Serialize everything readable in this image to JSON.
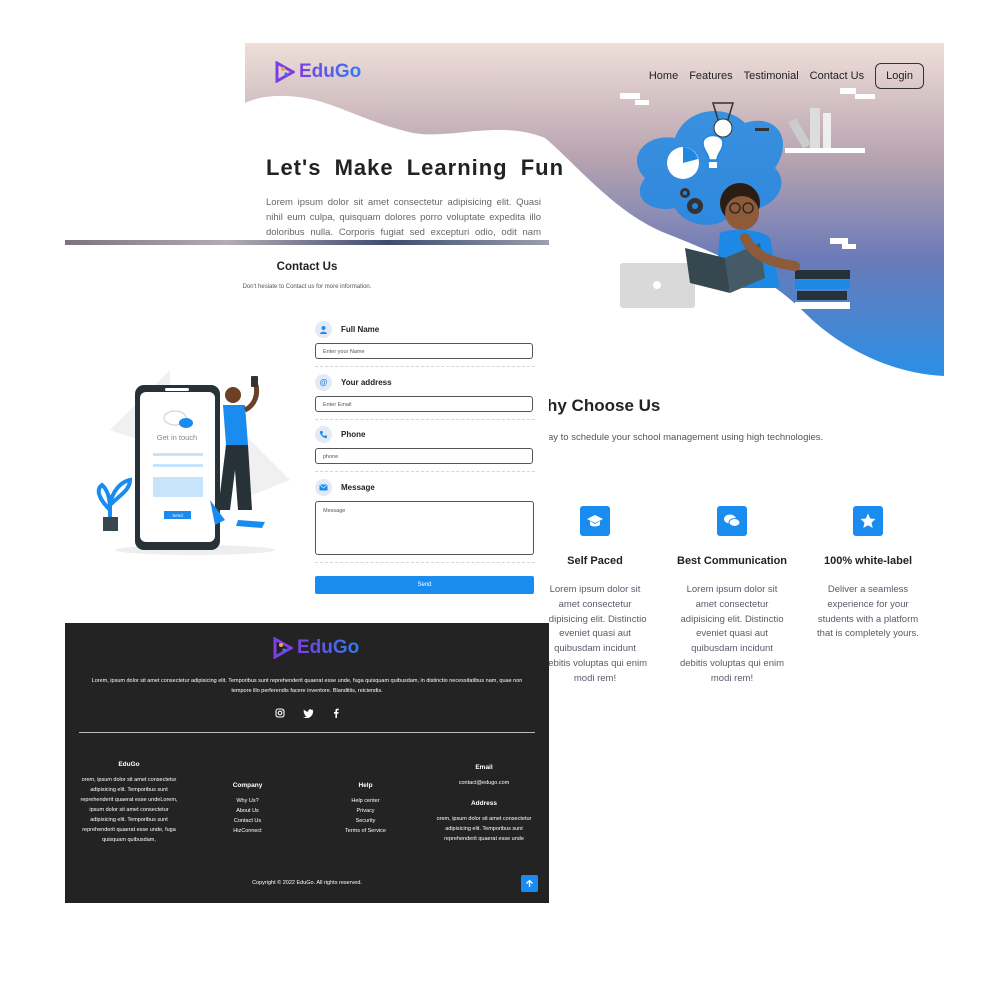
{
  "brand": {
    "name": "EduGo",
    "accent": "#1a8cf0",
    "footer_bg": "#232323"
  },
  "hero": {
    "nav": [
      "Home",
      "Features",
      "Testimonial",
      "Contact Us"
    ],
    "login_label": "Login",
    "title": "Let's Make Learning Fun",
    "lead": "Lorem ipsum dolor sit amet consectetur adipisicing elit. Quasi nihil eum culpa, quisquam dolores porro voluptate expedita illo doloribus nulla. Corporis fugiat sed excepturi odio, odit nam officia"
  },
  "why": {
    "title": "hy Choose Us",
    "subtitle": "ay to schedule your school management using high technologies.",
    "features": [
      {
        "icon": "graduation-cap-icon",
        "title": "Self Paced",
        "desc": "Lorem ipsum dolor sit amet consectetur adipisicing elit. Distinctio eveniet quasi aut quibusdam incidunt debitis voluptas qui enim modi rem!"
      },
      {
        "icon": "chat-bubbles-icon",
        "title": "Best Communication",
        "desc": "Lorem ipsum dolor sit amet consectetur adipisicing elit. Distinctio eveniet quasi aut quibusdam incidunt debitis voluptas qui enim modi rem!"
      },
      {
        "icon": "star-icon",
        "title": "100% white-label",
        "desc": "Deliver a seamless experience for your students with a platform that is completely yours."
      }
    ]
  },
  "contact": {
    "title": "Contact Us",
    "hint": "Don't hesiate to Contact us for more information.",
    "fields": [
      {
        "label": "Full Name",
        "placeholder": "Enter your Name",
        "icon": "user-icon"
      },
      {
        "label": "Your address",
        "placeholder": "Enter Email",
        "icon": "at-icon"
      },
      {
        "label": "Phone",
        "placeholder": "phone",
        "icon": "phone-icon"
      },
      {
        "label": "Message",
        "placeholder": "Message",
        "icon": "envelope-icon"
      }
    ],
    "send_label": "Send",
    "illustration": {
      "caption": "Get in touch",
      "send_label": "Send"
    }
  },
  "footer": {
    "about": "Lorem, ipsum dolor sit amet consectetur adipisicing elit. Temporibus sunt reprehenderit quaerat esse unde, fuga quisquam quibusdam, in distinctio necessitatibus nam, quae non tempore illo perferendis facere inventore. Blanditiis, reiciendis.",
    "social": [
      "instagram-icon",
      "twitter-icon",
      "facebook-icon"
    ],
    "edugo_title": "EduGo",
    "edugo_text": "orem, ipsum dolor sit amet consectetur adipisicing elit. Temporibus sunt reprehenderit quaerat esse undeLorem, ipsum dolor sit amet consectetur adipisicing elit. Temporibus sunt reprehenderit quaerat esse unde, fuga quisquam quibusdam,",
    "company_title": "Company",
    "company_links": [
      "Why Us?",
      "About Us",
      "Contact Us",
      "HizConnect"
    ],
    "help_title": "Help",
    "help_links": [
      "Help center",
      "Privacy",
      "Security",
      "Terms of Service"
    ],
    "email_title": "Email",
    "email": "contact@edugo.com",
    "address_title": "Address",
    "address": "orem, ipsum dolor sit amet consectetur adipisicing elit. Temporibus sunt reprehenderit quaerat esse unde",
    "copyright": "Copyright © 2022 EduGo. All rights reserved."
  }
}
